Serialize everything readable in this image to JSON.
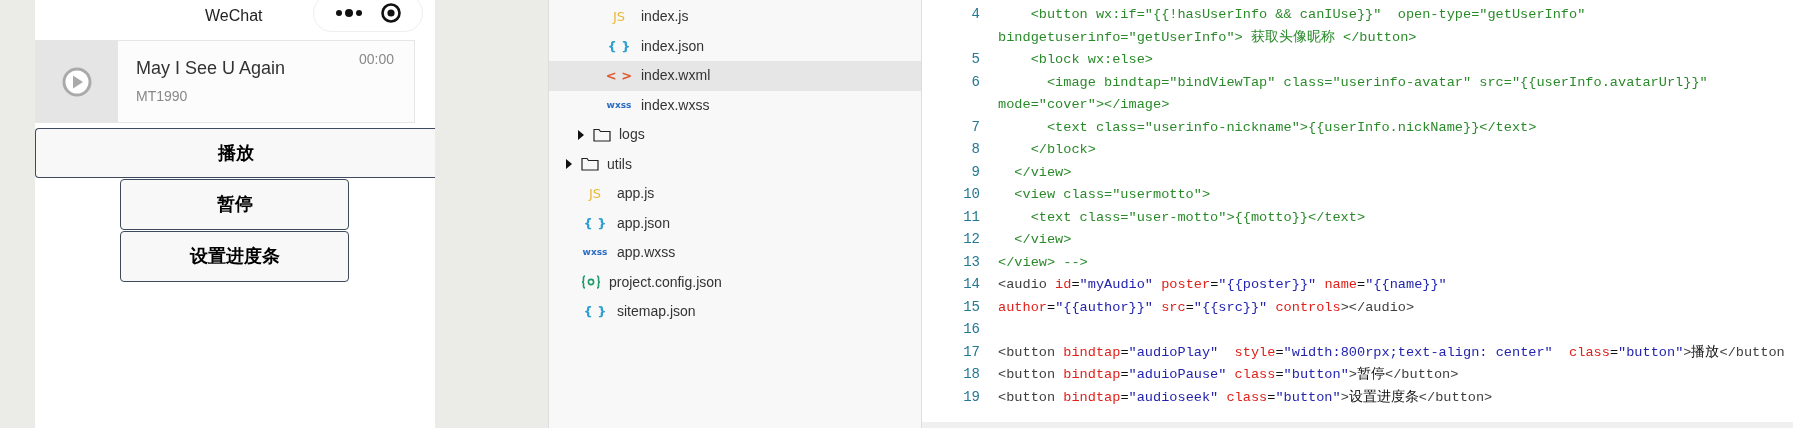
{
  "simulator": {
    "title": "WeChat",
    "audio": {
      "name": "May I See U Again",
      "author": "MT1990",
      "time": "00:00"
    },
    "buttons": [
      {
        "label": "播放",
        "kind": "wide"
      },
      {
        "label": "暂停",
        "kind": "normal"
      },
      {
        "label": "设置进度条",
        "kind": "normal"
      }
    ]
  },
  "file_tree": [
    {
      "children": [
        {
          "children": [
            {
              "label": "index.js",
              "kind": "js",
              "badge": "JS",
              "selected": false
            },
            {
              "label": "index.json",
              "kind": "json",
              "badge": "{ }",
              "selected": false
            },
            {
              "label": "index.wxml",
              "kind": "wxml",
              "badge": "< >",
              "selected": true
            },
            {
              "label": "index.wxss",
              "kind": "wxss",
              "badge": "wxss",
              "selected": false
            }
          ]
        },
        {
          "label": "logs",
          "kind": "folder",
          "expanded": false,
          "selected": false
        }
      ]
    },
    {
      "label": "utils",
      "kind": "folder",
      "expanded": false,
      "selected": false
    },
    {
      "label": "app.js",
      "kind": "js",
      "badge": "JS",
      "selected": false
    },
    {
      "label": "app.json",
      "kind": "json",
      "badge": "{ }",
      "selected": false
    },
    {
      "label": "app.wxss",
      "kind": "wxss",
      "badge": "wxss",
      "selected": false
    },
    {
      "label": "project.config.json",
      "kind": "config",
      "selected": false
    },
    {
      "label": "sitemap.json",
      "kind": "json",
      "badge": "{ }",
      "selected": false
    }
  ],
  "code": [
    {
      "number": "4",
      "rows": [
        [
          {
            "kind": "comment",
            "text": "    <button wx:if=\"{{!hasUserInfo && canIUse}}\"  open-type=\"getUserInfo\""
          }
        ],
        [
          {
            "kind": "comment",
            "text": "bindgetuserinfo=\"getUserInfo\"> 获取头像昵称 </button>"
          }
        ]
      ]
    },
    {
      "number": "5",
      "rows": [
        [
          {
            "kind": "comment",
            "text": "    <block wx:else>"
          }
        ]
      ]
    },
    {
      "number": "6",
      "rows": [
        [
          {
            "kind": "comment",
            "text": "      <image bindtap=\"bindViewTap\" class=\"userinfo-avatar\" src=\"{{userInfo.avatarUrl}}\""
          }
        ],
        [
          {
            "kind": "comment",
            "text": "mode=\"cover\"></image>"
          }
        ]
      ]
    },
    {
      "number": "7",
      "rows": [
        [
          {
            "kind": "comment",
            "text": "      <text class=\"userinfo-nickname\">{{userInfo.nickName}}</text>"
          }
        ]
      ]
    },
    {
      "number": "8",
      "rows": [
        [
          {
            "kind": "comment",
            "text": "    </block>"
          }
        ]
      ]
    },
    {
      "number": "9",
      "rows": [
        [
          {
            "kind": "comment",
            "text": "  </view>"
          }
        ]
      ]
    },
    {
      "number": "10",
      "rows": [
        [
          {
            "kind": "comment",
            "text": "  <view class=\"usermotto\">"
          }
        ]
      ]
    },
    {
      "number": "11",
      "rows": [
        [
          {
            "kind": "comment",
            "text": "    <text class=\"user-motto\">{{motto}}</text>"
          }
        ]
      ]
    },
    {
      "number": "12",
      "rows": [
        [
          {
            "kind": "comment",
            "text": "  </view>"
          }
        ]
      ]
    },
    {
      "number": "13",
      "rows": [
        [
          {
            "kind": "comment",
            "text": "</view> -->"
          }
        ]
      ]
    },
    {
      "number": "14",
      "rows": [
        [
          {
            "kind": "tag",
            "text": "<audio"
          },
          {
            "kind": "attr",
            "text": " id"
          },
          {
            "kind": "text",
            "text": "="
          },
          {
            "kind": "value",
            "text": "\"myAudio\""
          },
          {
            "kind": "attr",
            "text": " poster"
          },
          {
            "kind": "text",
            "text": "="
          },
          {
            "kind": "value",
            "text": "\"{{poster}}\""
          },
          {
            "kind": "attr",
            "text": " name"
          },
          {
            "kind": "text",
            "text": "="
          },
          {
            "kind": "value",
            "text": "\"{{name}}\""
          }
        ]
      ]
    },
    {
      "number": "15",
      "rows": [
        [
          {
            "kind": "attr",
            "text": "author"
          },
          {
            "kind": "text",
            "text": "="
          },
          {
            "kind": "value",
            "text": "\"{{author}}\""
          },
          {
            "kind": "attr",
            "text": " src"
          },
          {
            "kind": "text",
            "text": "="
          },
          {
            "kind": "value",
            "text": "\"{{src}}\""
          },
          {
            "kind": "attr",
            "text": " controls"
          },
          {
            "kind": "tag",
            "text": "></audio>"
          }
        ]
      ]
    },
    {
      "number": "16",
      "rows": [
        []
      ]
    },
    {
      "number": "17",
      "rows": [
        [
          {
            "kind": "tag",
            "text": "<button"
          },
          {
            "kind": "attr",
            "text": " bindtap"
          },
          {
            "kind": "text",
            "text": "="
          },
          {
            "kind": "value",
            "text": "\"audioPlay\""
          },
          {
            "kind": "attr",
            "text": "  style"
          },
          {
            "kind": "text",
            "text": "="
          },
          {
            "kind": "value",
            "text": "\"width:800rpx;text-align: center\""
          },
          {
            "kind": "attr",
            "text": "  class"
          },
          {
            "kind": "text",
            "text": "="
          },
          {
            "kind": "value",
            "text": "\"button\""
          },
          {
            "kind": "tag",
            "text": ">"
          },
          {
            "kind": "text",
            "text": "播放"
          },
          {
            "kind": "tag",
            "text": "</button"
          }
        ]
      ]
    },
    {
      "number": "18",
      "rows": [
        [
          {
            "kind": "tag",
            "text": "<button"
          },
          {
            "kind": "attr",
            "text": " bindtap"
          },
          {
            "kind": "text",
            "text": "="
          },
          {
            "kind": "value",
            "text": "\"aduioPause\""
          },
          {
            "kind": "attr",
            "text": " class"
          },
          {
            "kind": "text",
            "text": "="
          },
          {
            "kind": "value",
            "text": "\"button\""
          },
          {
            "kind": "tag",
            "text": ">"
          },
          {
            "kind": "text",
            "text": "暂停"
          },
          {
            "kind": "tag",
            "text": "</button>"
          }
        ]
      ]
    },
    {
      "number": "19",
      "rows": [
        [
          {
            "kind": "tag",
            "text": "<button"
          },
          {
            "kind": "attr",
            "text": " bindtap"
          },
          {
            "kind": "text",
            "text": "="
          },
          {
            "kind": "value",
            "text": "\"audioseek\""
          },
          {
            "kind": "attr",
            "text": " class"
          },
          {
            "kind": "text",
            "text": "="
          },
          {
            "kind": "value",
            "text": "\"button\""
          },
          {
            "kind": "tag",
            "text": ">"
          },
          {
            "kind": "text",
            "text": "设置进度条"
          },
          {
            "kind": "tag",
            "text": "</button>"
          }
        ]
      ]
    }
  ]
}
